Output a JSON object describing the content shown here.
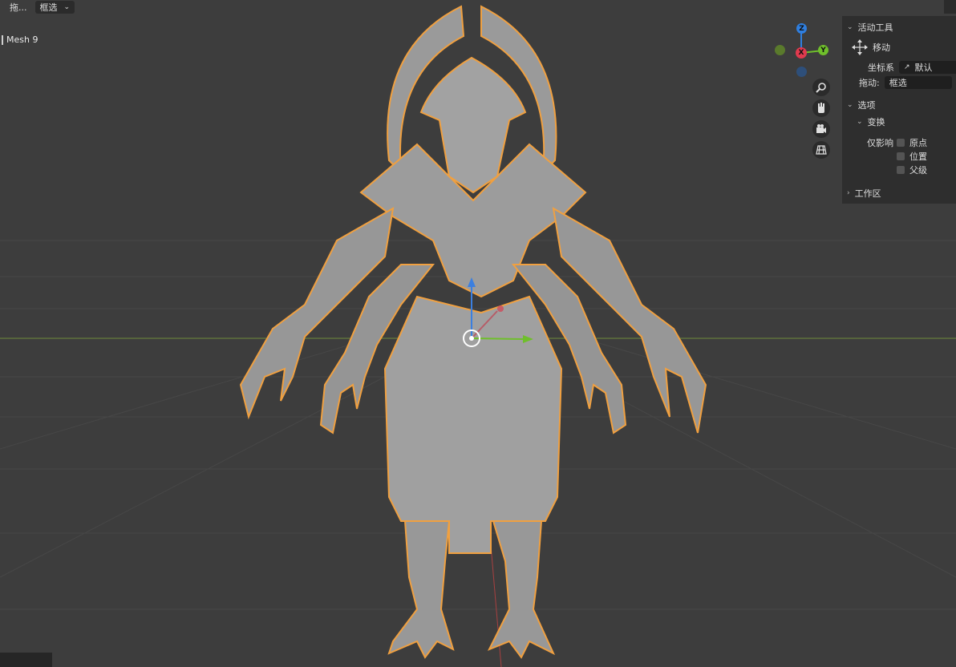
{
  "header": {
    "drag_label": "拖...",
    "select_mode": "框选"
  },
  "viewport": {
    "object_name": "Mesh 9"
  },
  "gizmo": {
    "axes": {
      "z": "Z",
      "x": "X",
      "y": "Y"
    },
    "colors": {
      "z": "#2f7fe0",
      "x": "#e03a4e",
      "y": "#6fbf2b",
      "neg_y": "#5a7a2c",
      "neg_z": "#2e4f7a"
    }
  },
  "nav_tools": [
    "zoom-icon",
    "hand-pan-icon",
    "camera-icon",
    "grid-view-icon"
  ],
  "sidebar": {
    "active_tool_header": "活动工具",
    "tool_name": "移动",
    "orientation_label": "坐标系",
    "orientation_value": "默认",
    "drag_label": "拖动:",
    "drag_value": "框选",
    "options_header": "选项",
    "transform_header": "变换",
    "affect_only_label": "仅影响",
    "affect_origin": "原点",
    "affect_location": "位置",
    "affect_parent": "父级",
    "workspace_header": "工作区"
  },
  "colors": {
    "background": "#3d3d3d",
    "selection_outline": "#f0a040",
    "mesh": "#9a9a9a"
  }
}
